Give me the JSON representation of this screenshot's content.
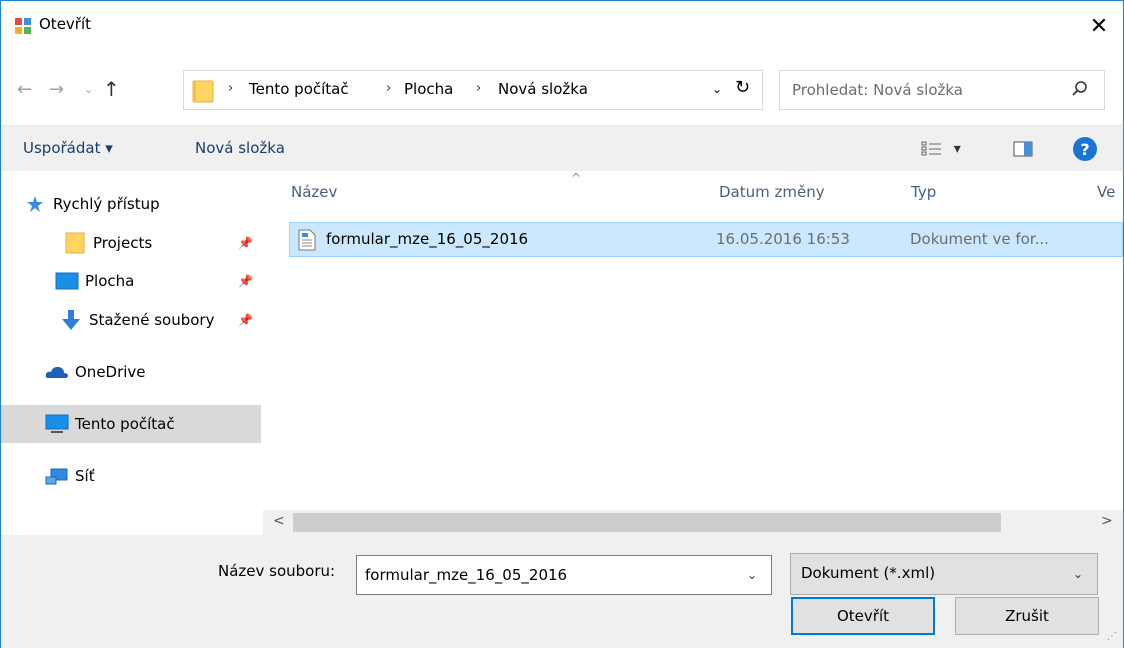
{
  "window": {
    "title": "Otevřít",
    "close_glyph": "✕"
  },
  "address": {
    "crumbs": [
      "Tento počítač",
      "Plocha",
      "Nová složka"
    ],
    "separator": "›",
    "back_glyph": "←",
    "forward_glyph": "→",
    "recent_glyph": "⌄",
    "up_glyph": "↑",
    "dropdown_glyph": "⌄",
    "refresh_glyph": "↻"
  },
  "search": {
    "placeholder": "Prohledat: Nová složka"
  },
  "toolbar": {
    "organize": "Uspořádat ▾",
    "new_folder": "Nová složka",
    "view_glyph": "▾",
    "help": "?"
  },
  "sidebar": {
    "items": [
      {
        "label": "Rychlý přístup",
        "icon": "star-icon"
      },
      {
        "label": "Projects",
        "icon": "folder-icon",
        "pinned": true
      },
      {
        "label": "Plocha",
        "icon": "desktop-icon",
        "pinned": true
      },
      {
        "label": "Stažené soubory",
        "icon": "download-icon",
        "pinned": true
      },
      {
        "label": "OneDrive",
        "icon": "cloud-icon"
      },
      {
        "label": "Tento počítač",
        "icon": "computer-icon",
        "selected": true
      },
      {
        "label": "Síť",
        "icon": "network-icon"
      }
    ],
    "pin_glyph": "📌"
  },
  "columns": {
    "name": "Název",
    "date": "Datum změny",
    "type": "Typ",
    "size": "Ve",
    "sort_glyph": "^"
  },
  "files": [
    {
      "name": "formular_mze_16_05_2016",
      "date": "16.05.2016 16:53",
      "type": "Dokument ve for..."
    }
  ],
  "scroll": {
    "left": "<",
    "right": ">"
  },
  "bottom": {
    "filename_label": "Název souboru:",
    "filename_value": "formular_mze_16_05_2016",
    "filter_value": "Dokument (*.xml)",
    "dropdown_glyph": "⌄",
    "open": "Otevřít",
    "cancel": "Zrušit",
    "grip": "⋰"
  },
  "colors": {
    "accent": "#0078d7",
    "selection": "#cce8ff",
    "chrome": "#f0f0f0"
  }
}
